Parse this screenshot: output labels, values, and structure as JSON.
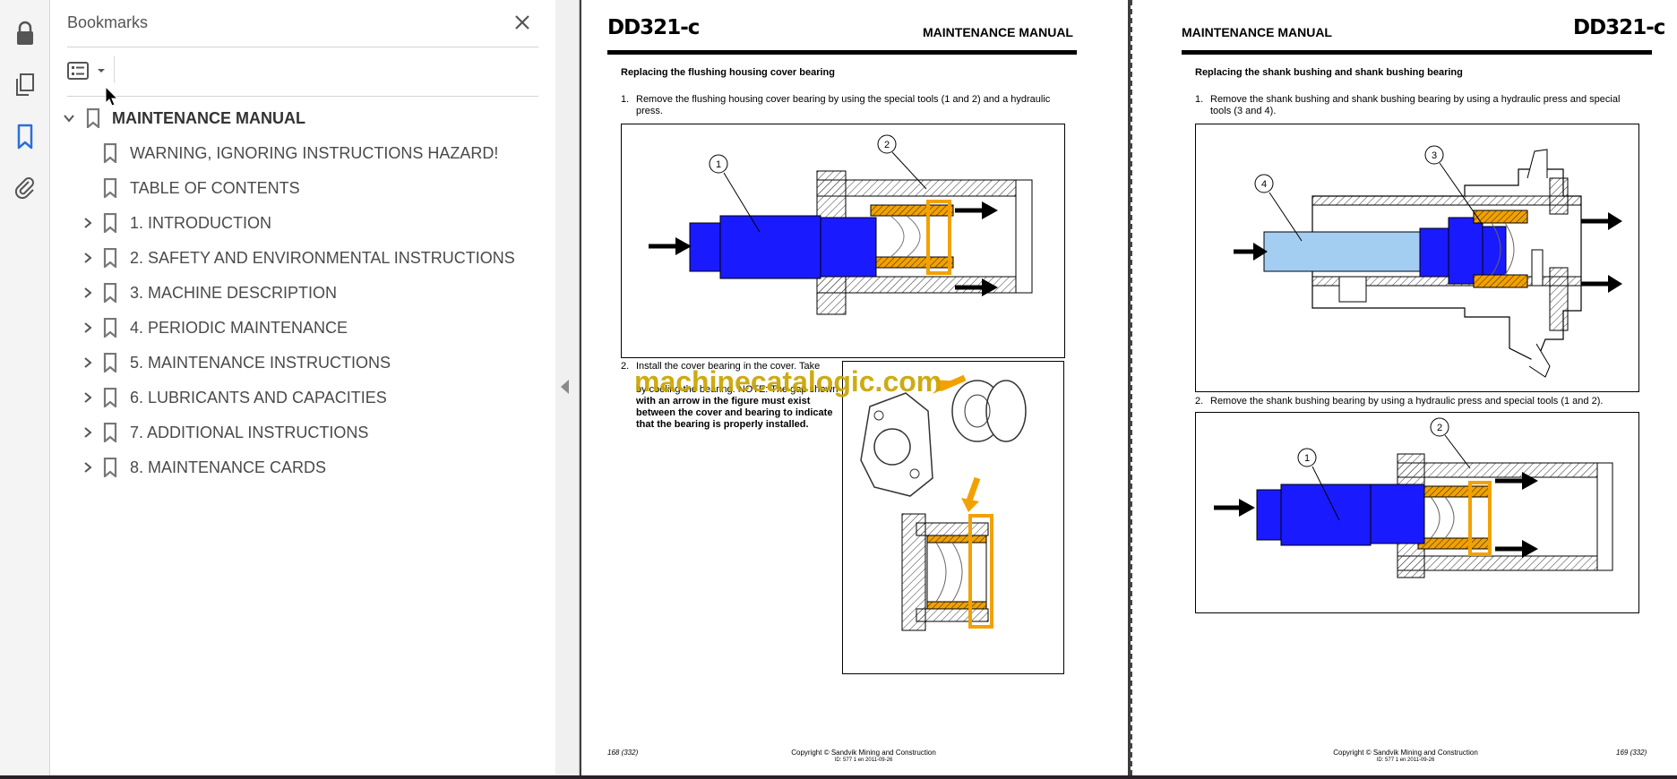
{
  "panel": {
    "title": "Bookmarks",
    "items": [
      {
        "label": "MAINTENANCE MANUAL",
        "expanded": true
      },
      {
        "label": "WARNING, IGNORING INSTRUCTIONS HAZARD!"
      },
      {
        "label": "TABLE OF CONTENTS"
      },
      {
        "label": "1. INTRODUCTION"
      },
      {
        "label": "2. SAFETY AND ENVIRONMENTAL INSTRUCTIONS"
      },
      {
        "label": "3. MACHINE DESCRIPTION"
      },
      {
        "label": "4. PERIODIC MAINTENANCE"
      },
      {
        "label": "5. MAINTENANCE INSTRUCTIONS"
      },
      {
        "label": "6. LUBRICANTS AND CAPACITIES"
      },
      {
        "label": "7. ADDITIONAL INSTRUCTIONS"
      },
      {
        "label": "8. MAINTENANCE CARDS"
      }
    ]
  },
  "rail": {
    "icons": [
      "lock-icon",
      "pages-icon",
      "bookmark-icon",
      "attachment-icon"
    ]
  },
  "left_page": {
    "model": "DD321-c",
    "header": "MAINTENANCE MANUAL",
    "section": "Replacing the flushing housing cover bearing",
    "step1_num": "1.",
    "step1_line1": "Remove the flushing housing cover bearing by using the special tools (1 and 2) and a hydraulic",
    "step1_line2": "press.",
    "fig1_callouts": [
      "1",
      "2"
    ],
    "step2_num": "2.",
    "step2_line1": "Install the cover bearing in the cover. Take",
    "step2_line2": "",
    "step2_line3": "by cooling the bearing. NOTE: The gap shown",
    "step2_line4": "with an arrow in the figure must exist",
    "step2_line5": "between the cover and bearing to indicate",
    "step2_line6": "that the bearing is properly installed.",
    "page_no": "168 (332)",
    "copyright": "Copyright © Sandvik Mining and Construction",
    "doc_id": "ID: 577 1 en 2011-09-26"
  },
  "right_page": {
    "model": "DD321-c",
    "header": "MAINTENANCE MANUAL",
    "section": "Replacing the shank bushing and shank bushing bearing",
    "step1_num": "1.",
    "step1_line1": "Remove the shank bushing and shank bushing bearing by using a hydraulic press and special",
    "step1_line2": "tools (3 and 4).",
    "fig1_callouts": [
      "3",
      "4"
    ],
    "step2_num": "2.",
    "step2_text": "Remove the shank bushing bearing by using a hydraulic press and special tools (1 and 2).",
    "fig2_callouts": [
      "1",
      "2"
    ],
    "page_no": "169 (332)",
    "copyright": "Copyright © Sandvik Mining and Construction",
    "doc_id": "ID: 577 1 en 2011-09-26"
  },
  "watermark": "machinecatalogic.com",
  "colors": {
    "blue": "#1a1aff",
    "light_blue": "#a4cdf2",
    "orange": "#f2a100",
    "accent": "#2a6fd6"
  }
}
